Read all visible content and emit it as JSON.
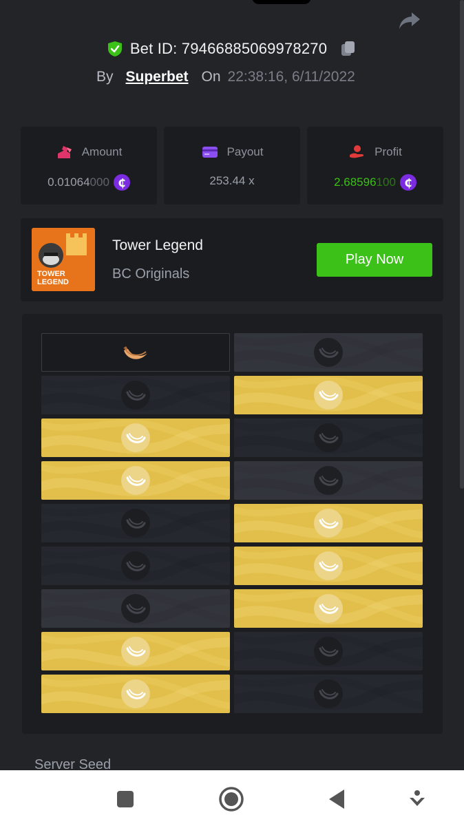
{
  "header": {
    "bet_id_label": "Bet ID: 79466885069978270",
    "by_label": "By",
    "username": "Superbet",
    "on_label": "On",
    "timestamp": "22:38:16, 6/11/2022"
  },
  "stats": {
    "amount": {
      "label": "Amount",
      "value_main": "0.01064",
      "value_dim": "000",
      "coin": "₵"
    },
    "payout": {
      "label": "Payout",
      "value": "253.44 x"
    },
    "profit": {
      "label": "Profit",
      "value_main": "2.68596",
      "value_dim": "100",
      "coin": "₵"
    }
  },
  "game": {
    "title": "Tower Legend",
    "provider": "BC Originals",
    "play_label": "Play Now",
    "thumb_text": [
      "TOWER",
      "LEGEND"
    ]
  },
  "board": {
    "rows": [
      [
        "empty-banana",
        "dark-mid"
      ],
      [
        "dark",
        "gold"
      ],
      [
        "gold",
        "dark"
      ],
      [
        "gold",
        "dark-mid"
      ],
      [
        "dark",
        "gold"
      ],
      [
        "dark",
        "gold"
      ],
      [
        "dark-mid",
        "gold"
      ],
      [
        "gold",
        "dark"
      ],
      [
        "gold",
        "dark"
      ]
    ]
  },
  "seed": {
    "label": "Server Seed"
  },
  "colors": {
    "accent_green": "#3bc117",
    "gold": "#e2bf4a",
    "coin_purple": "#7b2be0"
  },
  "icons": {
    "share": "share-icon",
    "shield": "shield-check-icon",
    "copy": "copy-icon",
    "nav": [
      "square-icon",
      "circle-icon",
      "back-triangle-icon",
      "download-icon"
    ]
  }
}
